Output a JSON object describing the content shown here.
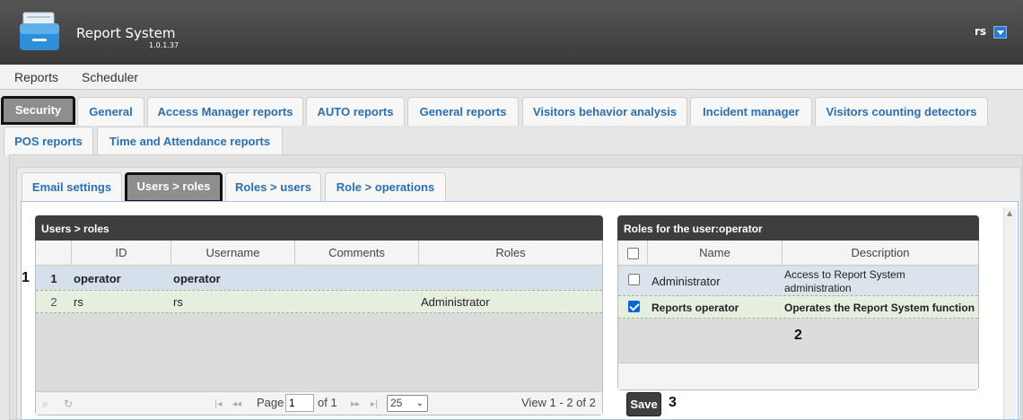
{
  "app": {
    "title": "Report System",
    "version": "1.0.1.37",
    "user": "rs"
  },
  "menu": [
    {
      "label": "Reports"
    },
    {
      "label": "Scheduler"
    }
  ],
  "tabs_row1": [
    {
      "label": "Security"
    },
    {
      "label": "General"
    },
    {
      "label": "Access Manager reports"
    },
    {
      "label": "AUTO reports"
    },
    {
      "label": "General reports"
    },
    {
      "label": "Visitors behavior analysis"
    },
    {
      "label": "Incident manager"
    },
    {
      "label": "Visitors counting detectors"
    }
  ],
  "tabs_row2": [
    {
      "label": "POS reports"
    },
    {
      "label": "Time and Attendance reports"
    }
  ],
  "subtabs": [
    {
      "label": "Email settings"
    },
    {
      "label": "Users > roles"
    },
    {
      "label": "Roles > users"
    },
    {
      "label": "Role > operations"
    }
  ],
  "users_grid": {
    "title": "Users > roles",
    "columns": [
      "ID",
      "Username",
      "Comments",
      "Roles"
    ],
    "rows": [
      {
        "num": "1",
        "id": "operator",
        "username": "operator",
        "comments": "",
        "roles": ""
      },
      {
        "num": "2",
        "id": "rs",
        "username": "rs",
        "comments": "",
        "roles": "Administrator"
      }
    ],
    "pager": {
      "page_label": "Page",
      "page_value": "1",
      "of_label": "of 1",
      "page_size": "25",
      "view_text": "View 1 - 2 of 2"
    }
  },
  "roles_grid": {
    "title": "Roles for the user:operator",
    "columns": [
      "Name",
      "Description"
    ],
    "rows": [
      {
        "checked": false,
        "name": "Administrator",
        "description_line1": "Access to Report System",
        "description_line2": "administration"
      },
      {
        "checked": true,
        "name": "Reports operator",
        "description_line1": "Operates the Report System function",
        "description_line2": ""
      }
    ]
  },
  "save_label": "Save",
  "callouts": {
    "c1": "1",
    "c2": "2",
    "c3": "3"
  },
  "colors": {
    "accent_blue": "#2a6fb5",
    "header_dark": "#3e3e3e",
    "selected_row": "#d6e0ec",
    "alt_row": "#e6efdf"
  }
}
